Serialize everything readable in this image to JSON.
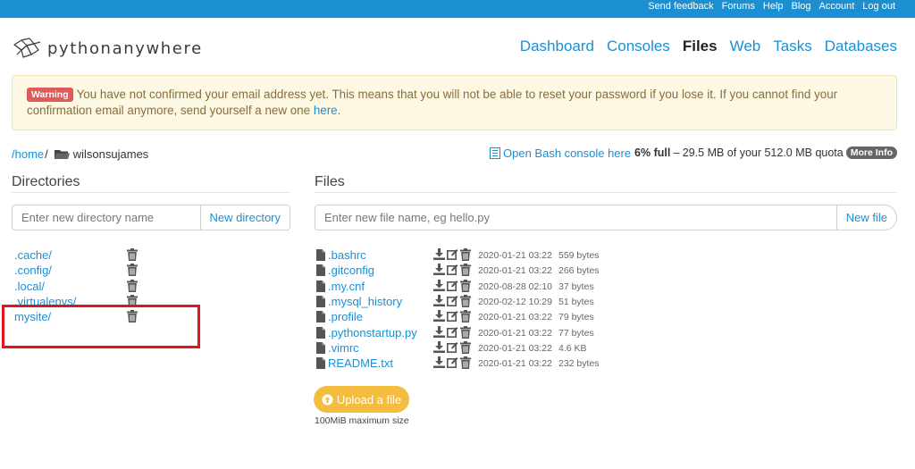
{
  "topbar": {
    "links": [
      "Send feedback",
      "Forums",
      "Help",
      "Blog",
      "Account",
      "Log out"
    ]
  },
  "logo": {
    "text": "pythonanywhere"
  },
  "nav": {
    "items": [
      "Dashboard",
      "Consoles",
      "Files",
      "Web",
      "Tasks",
      "Databases"
    ],
    "active": "Files"
  },
  "warning": {
    "badge": "Warning",
    "message": "You have not confirmed your email address yet. This means that you will not be able to reset your password if you lose it. If you cannot find your confirmation email anymore, send yourself a new one",
    "link_text": "here",
    "end": "."
  },
  "breadcrumb": {
    "home": "/home",
    "sep": "/",
    "user": "wilsonsujames"
  },
  "bash_link": "Open Bash console here",
  "quota": {
    "percent_full": "6% full",
    "text": " – 29.5 MB of your 512.0 MB quota",
    "more_info": "More Info",
    "fraction_used": 0.06
  },
  "directories": {
    "title": "Directories",
    "placeholder": "Enter new directory name",
    "button": "New directory",
    "items": [
      ".cache/",
      ".config/",
      ".local/",
      ".virtualenvs/",
      "mysite/"
    ]
  },
  "files": {
    "title": "Files",
    "placeholder": "Enter new file name, eg hello.py",
    "button": "New file",
    "items": [
      {
        "name": ".bashrc",
        "date": "2020-01-21 03:22",
        "size": "559 bytes"
      },
      {
        "name": ".gitconfig",
        "date": "2020-01-21 03:22",
        "size": "266 bytes"
      },
      {
        "name": ".my.cnf",
        "date": "2020-08-28 02:10",
        "size": "37 bytes"
      },
      {
        "name": ".mysql_history",
        "date": "2020-02-12 10:29",
        "size": "51 bytes"
      },
      {
        "name": ".profile",
        "date": "2020-01-21 03:22",
        "size": "79 bytes"
      },
      {
        "name": ".pythonstartup.py",
        "date": "2020-01-21 03:22",
        "size": "77 bytes"
      },
      {
        "name": ".vimrc",
        "date": "2020-01-21 03:22",
        "size": "4.6 KB"
      },
      {
        "name": "README.txt",
        "date": "2020-01-21 03:22",
        "size": "232 bytes"
      }
    ]
  },
  "upload": {
    "button": "Upload a file",
    "max_size": "100MiB maximum size"
  },
  "colors": {
    "accent": "#1b8fd2",
    "warning_bg": "#fcf8e3",
    "upload": "#f5bd3f",
    "highlight": "#e0141e"
  },
  "icons": {
    "folder": "folder-icon",
    "trash": "trash-icon",
    "file": "file-icon",
    "download": "download-icon",
    "edit": "edit-icon",
    "bash": "console-icon",
    "upload": "upload-icon"
  }
}
